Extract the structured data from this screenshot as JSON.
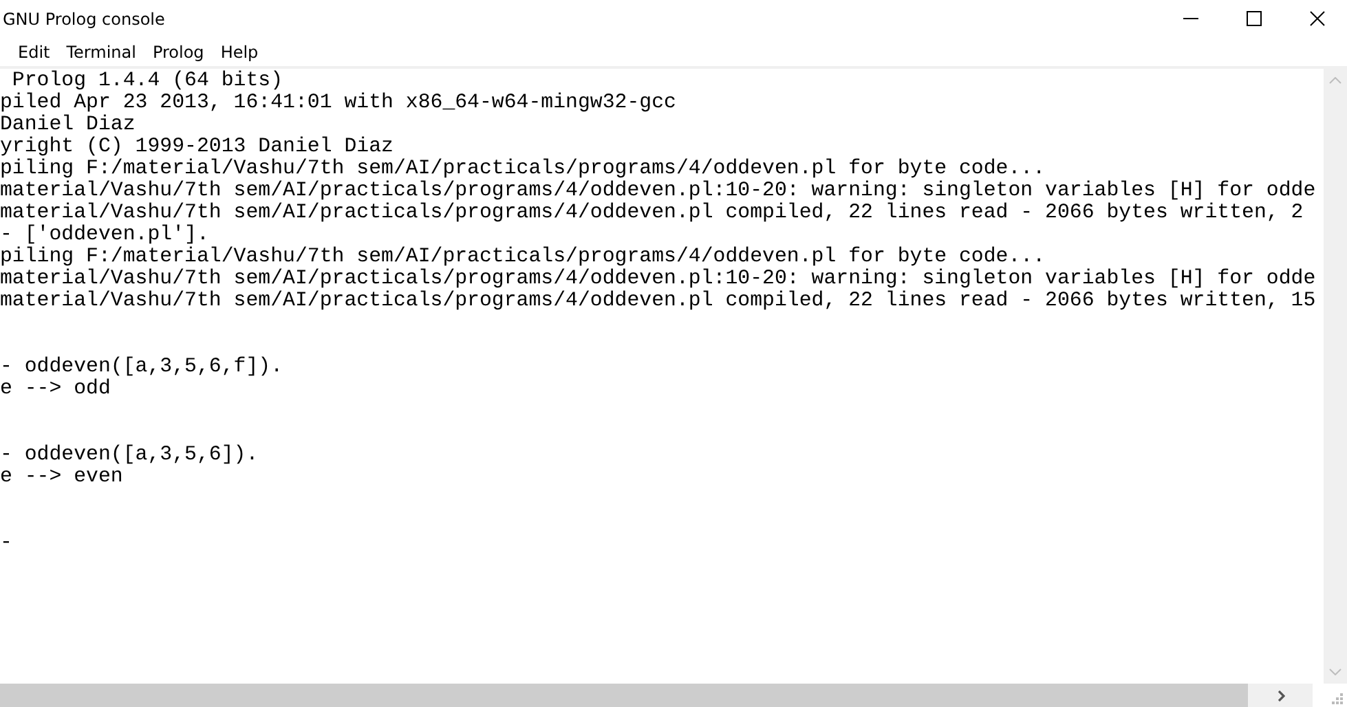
{
  "window": {
    "title": "GNU Prolog console"
  },
  "menu": [
    {
      "label": "Edit"
    },
    {
      "label": "Terminal"
    },
    {
      "label": "Prolog"
    },
    {
      "label": "Help"
    }
  ],
  "console": {
    "blocks": [
      {
        "lines": [
          " Prolog 1.4.4 (64 bits)",
          "piled Apr 23 2013, 16:41:01 with x86_64-w64-mingw32-gcc",
          "Daniel Diaz",
          "yright (C) 1999-2013 Daniel Diaz",
          "piling F:/material/Vashu/7th sem/AI/practicals/programs/4/oddeven.pl for byte code...",
          "material/Vashu/7th sem/AI/practicals/programs/4/oddeven.pl:10-20: warning: singleton variables [H] for odde",
          "material/Vashu/7th sem/AI/practicals/programs/4/oddeven.pl compiled, 22 lines read - 2066 bytes written, 2",
          "- ['oddeven.pl'].",
          "piling F:/material/Vashu/7th sem/AI/practicals/programs/4/oddeven.pl for byte code...",
          "material/Vashu/7th sem/AI/practicals/programs/4/oddeven.pl:10-20: warning: singleton variables [H] for odde",
          "material/Vashu/7th sem/AI/practicals/programs/4/oddeven.pl compiled, 22 lines read - 2066 bytes written, 15"
        ]
      },
      {
        "lines": [
          "- oddeven([a,3,5,6,f]).",
          "e --> odd"
        ]
      },
      {
        "lines": [
          "- oddeven([a,3,5,6]).",
          "e --> even"
        ]
      },
      {
        "lines": [
          "-"
        ]
      }
    ]
  }
}
